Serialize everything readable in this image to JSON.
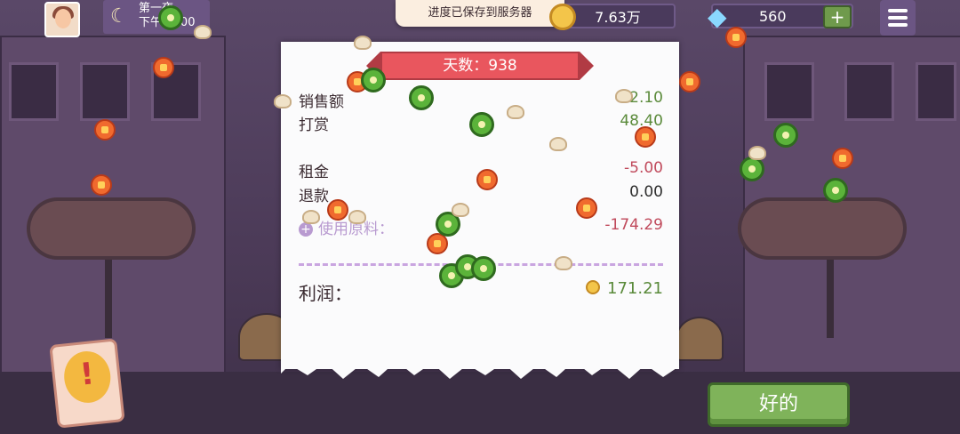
{
  "topbar": {
    "time_title": "第一夜",
    "time_clock": "下午11:00",
    "save_toast": "进度已保存到服务器",
    "money": "7.63万",
    "gems": "560",
    "gems_plus": "+"
  },
  "receipt": {
    "day_label": "天数：938",
    "sales_label": "销售额",
    "sales_value": "2.10",
    "tips_label": "打赏",
    "tips_value": "48.40",
    "rent_label": "租金",
    "rent_value": "-5.00",
    "refund_label": "退款",
    "refund_value": "0.00",
    "ingredients_label": "使用原料：",
    "ingredients_value": "-174.29",
    "profit_label": "利润：",
    "profit_value": "171.21"
  },
  "buttons": {
    "ok": "好的"
  },
  "colors": {
    "accent_green": "#7fb35a",
    "ribbon_red": "#e9565e",
    "positive": "#5a8a3a",
    "negative": "#c04a5c"
  }
}
